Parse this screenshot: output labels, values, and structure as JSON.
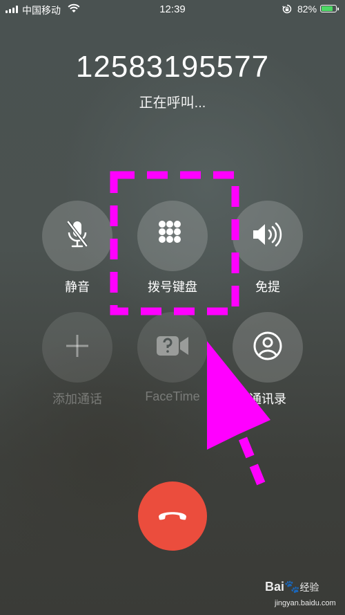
{
  "status_bar": {
    "carrier": "中国移动",
    "time": "12:39",
    "battery_percent": "82%",
    "battery_level": 0.82
  },
  "call": {
    "number": "12583195577",
    "status": "正在呼叫..."
  },
  "controls": {
    "mute": "静音",
    "keypad": "拨号键盘",
    "speaker": "免提",
    "add_call": "添加通话",
    "facetime": "FaceTime",
    "contacts": "通讯录"
  },
  "icons": {
    "mute": "mic-slash-icon",
    "keypad": "keypad-grid-icon",
    "speaker": "speaker-wave-icon",
    "add_call": "plus-icon",
    "facetime": "facetime-video-question-icon",
    "contacts": "person-circle-icon",
    "end_call": "phone-hangup-icon"
  },
  "colors": {
    "end_call": "#eb4d3d",
    "annotation": "#ff00ff",
    "battery": "#4cd964"
  },
  "watermark": {
    "brand": "Bai",
    "brand_suffix": "经验",
    "url": "jingyan.baidu.com"
  }
}
